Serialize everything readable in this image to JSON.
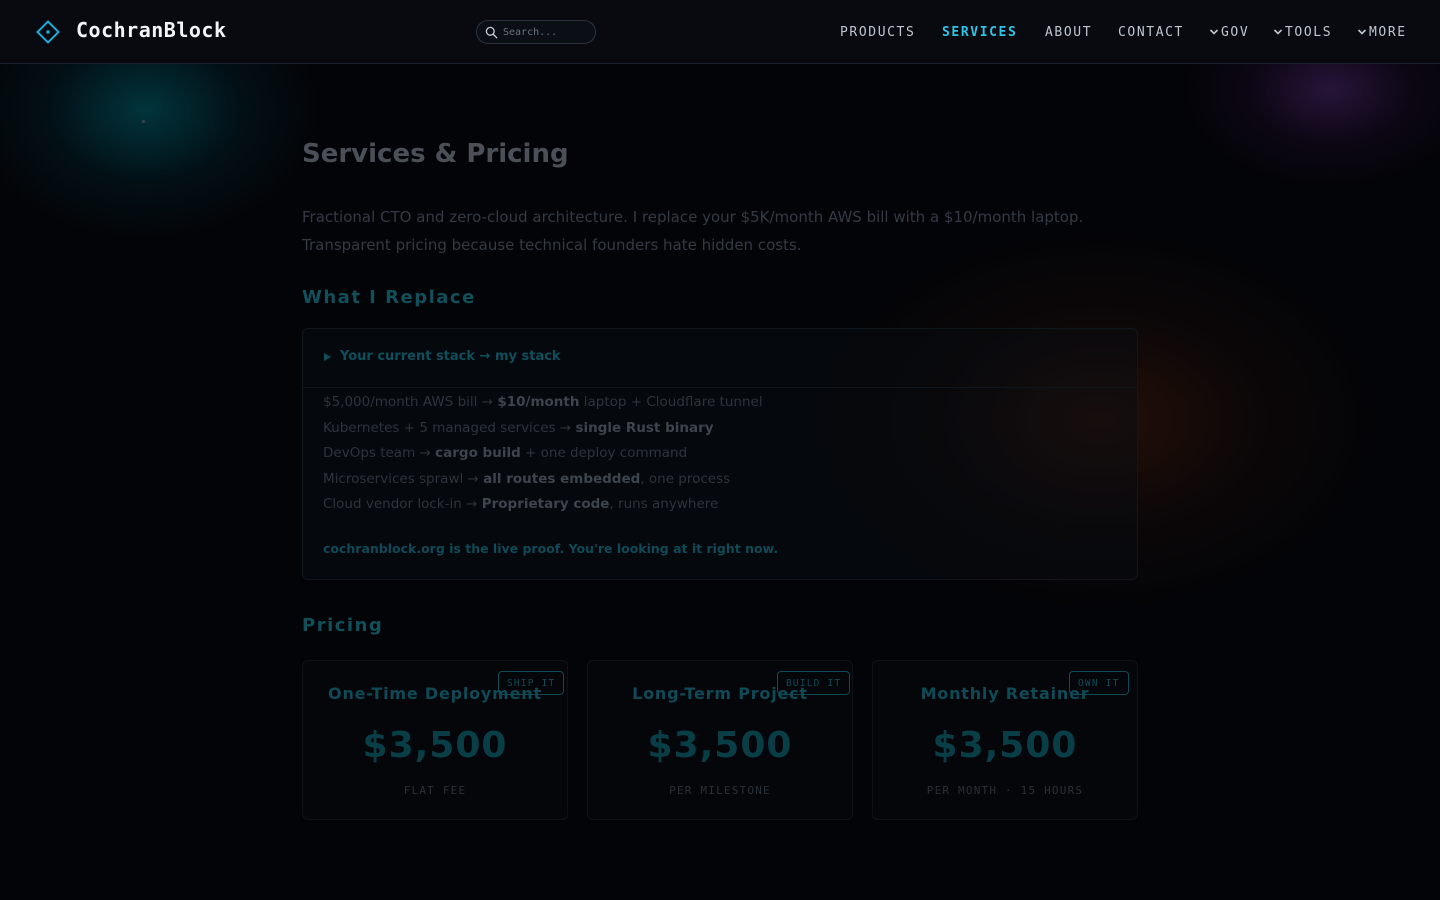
{
  "header": {
    "brand": "CochranBlock",
    "search_placeholder": "Search...",
    "nav": [
      {
        "label": "PRODUCTS",
        "active": false,
        "dropdown": false
      },
      {
        "label": "SERVICES",
        "active": true,
        "dropdown": false
      },
      {
        "label": "ABOUT",
        "active": false,
        "dropdown": false
      },
      {
        "label": "CONTACT",
        "active": false,
        "dropdown": false
      },
      {
        "label": "GOV",
        "active": false,
        "dropdown": true
      },
      {
        "label": "TOOLS",
        "active": false,
        "dropdown": true
      },
      {
        "label": "MORE",
        "active": false,
        "dropdown": true
      }
    ]
  },
  "colors": {
    "accent": "#2ec4e6",
    "background": "#030407"
  },
  "page": {
    "title": "Services & Pricing",
    "intro": "Fractional CTO and zero-cloud architecture. I replace your $5K/month AWS bill with a $10/month laptop. Transparent pricing because technical founders hate hidden costs."
  },
  "replace": {
    "heading": "What I Replace",
    "summary": "Your current stack → my stack",
    "rows": [
      {
        "before": "$5,000/month AWS bill → ",
        "bold": "$10/month",
        "after": " laptop + Cloudflare tunnel"
      },
      {
        "before": "Kubernetes + 5 managed services → ",
        "bold": "single Rust binary",
        "after": ""
      },
      {
        "before": "DevOps team → ",
        "bold": "cargo build",
        "after": " + one deploy command"
      },
      {
        "before": "Microservices sprawl → ",
        "bold": "all routes embedded",
        "after": ", one process"
      },
      {
        "before": "Cloud vendor lock-in → ",
        "bold": "Proprietary code",
        "after": ", runs anywhere"
      }
    ],
    "proof": "cochranblock.org is the live proof. You're looking at it right now."
  },
  "pricing": {
    "heading": "Pricing",
    "cards": [
      {
        "badge": "SHIP IT",
        "title": "One-Time Deployment",
        "price": "$3,500",
        "unit": "FLAT FEE"
      },
      {
        "badge": "BUILD IT",
        "title": "Long-Term Project",
        "price": "$3,500",
        "unit": "PER MILESTONE"
      },
      {
        "badge": "OWN IT",
        "title": "Monthly Retainer",
        "price": "$3,500",
        "unit": "PER MONTH · 15 HOURS"
      }
    ]
  }
}
